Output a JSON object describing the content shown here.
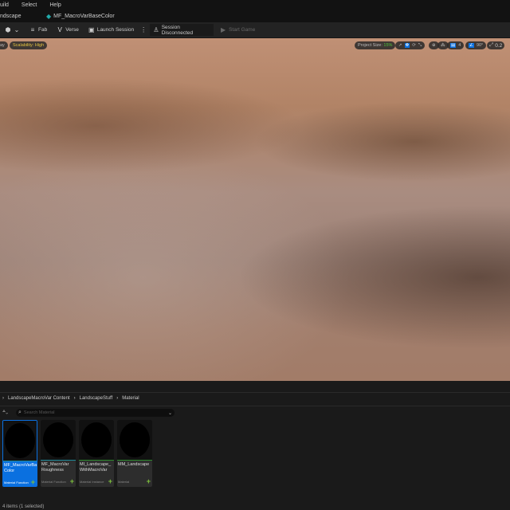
{
  "menu": [
    "uild",
    "Select",
    "Help"
  ],
  "tabs": {
    "left": "ndscape",
    "active": "MF_MacroVarBaseColor"
  },
  "toolbar": {
    "fab": "Fab",
    "verse": "Verse",
    "launch": "Launch Session",
    "session": "Session Disconnected",
    "start": "Start Game"
  },
  "viewport": {
    "mode": "ay",
    "scalability": "Scalability: High",
    "project_size_label": "Project Size:",
    "project_size": "15%",
    "grid": "4",
    "angle": "90°",
    "scale": "0.2"
  },
  "breadcrumb": [
    "LandscapeMacroVar Content",
    "LandscapeStuff",
    "Material"
  ],
  "search": {
    "placeholder": "Search Material"
  },
  "assets": [
    {
      "name": "MF_MacroVarBase Color",
      "type": "Material Function",
      "selected": true,
      "accent": "#1f8a9a"
    },
    {
      "name": "MF_MacroVar Roughness",
      "type": "Material Function",
      "selected": false,
      "accent": "#1f8a9a"
    },
    {
      "name": "MI_Landscape_ WithMacroVar",
      "type": "Material Instance",
      "selected": false,
      "accent": "#2d8a2d"
    },
    {
      "name": "MM_Landscape",
      "type": "Material",
      "selected": false,
      "accent": "#2d8a2d"
    }
  ],
  "status": "4 items (1 selected)",
  "colors": {
    "accent": "#0a70e0",
    "yellow": "#e0c040",
    "green": "#4ec43c"
  }
}
